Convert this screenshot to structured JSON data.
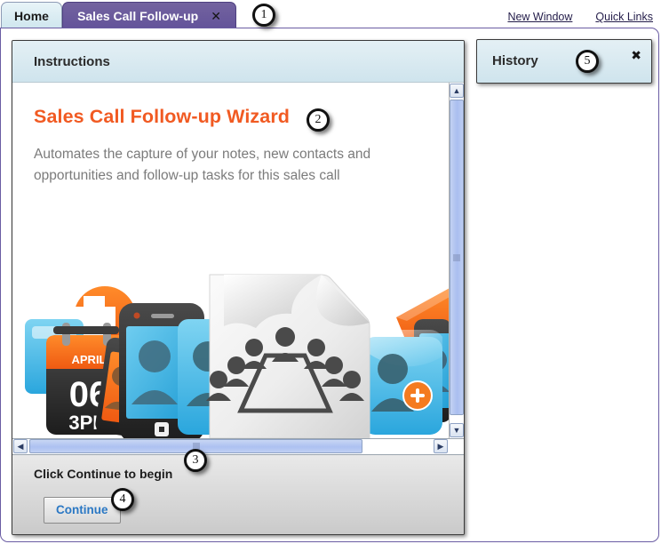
{
  "tabs": [
    {
      "label": "Home",
      "active": false
    },
    {
      "label": "Sales Call Follow-up",
      "active": true,
      "close": "✕"
    }
  ],
  "top_links": [
    {
      "label": "New Window"
    },
    {
      "label": "Quick Links"
    }
  ],
  "instructions_panel": {
    "header": "Instructions",
    "wizard_title": "Sales Call Follow-up Wizard",
    "description": "Automates the capture of your notes, new contacts and opportunities and follow-up tasks for this sales call",
    "illustration": {
      "name": "sales-call-collage",
      "calendar_month": "APRIL",
      "calendar_day": "06",
      "calendar_time": "3PM",
      "document_glyph": "meeting-table-people"
    },
    "footer_text": "Click Continue to begin",
    "continue_label": "Continue"
  },
  "history_panel": {
    "title": "History",
    "close": "✖"
  },
  "scrollbars": {
    "up_arrow": "▲",
    "down_arrow": "▼",
    "left_arrow": "◀",
    "right_arrow": "▶"
  },
  "callouts": [
    {
      "id": "1",
      "label": "1"
    },
    {
      "id": "2",
      "label": "2"
    },
    {
      "id": "3",
      "label": "3"
    },
    {
      "id": "4",
      "label": "4"
    },
    {
      "id": "5",
      "label": "5"
    }
  ],
  "colors": {
    "active_tab": "#63539a",
    "home_tab": "#cfe6ee",
    "wizard_title": "#f15a22",
    "panel_header": "#cfe4ed",
    "button_text": "#2b78c4",
    "link": "#241d4a"
  }
}
